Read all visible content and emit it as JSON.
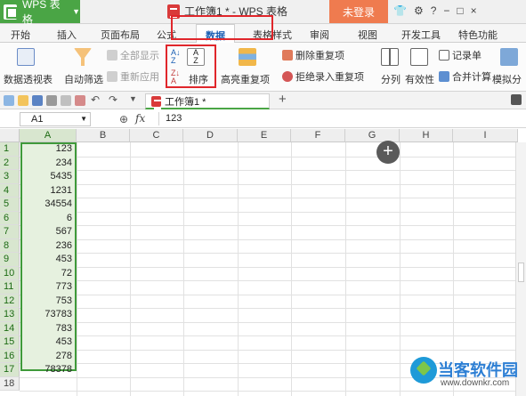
{
  "titlebar": {
    "app_name": "WPS 表格",
    "doc_title": "工作簿1 * - WPS 表格",
    "login": "未登录",
    "window_icons": [
      "T",
      "⊕",
      "?",
      "-",
      "□",
      "×"
    ]
  },
  "tabs": [
    "开始",
    "插入",
    "页面布局",
    "公式",
    "数据",
    "表格样式",
    "审阅",
    "视图",
    "开发工具",
    "特色功能"
  ],
  "active_tab": "数据",
  "ribbon": {
    "pivot": "数据透视表",
    "autofilter": "自动筛选",
    "show_all": "全部显示",
    "reapply": "重新应用",
    "sort": "排序",
    "highlight_dup": "高亮重复项",
    "remove_dup": "删除重复项",
    "reject_dup": "拒绝录入重复项",
    "split": "分列",
    "validity": "有效性",
    "record": "记录单",
    "consolidate": "合并计算",
    "simulate": "模拟分"
  },
  "sheet_tab": "工作簿1 *",
  "formula_bar": {
    "namebox": "A1",
    "fx": "fx",
    "value": "123"
  },
  "columns": [
    "A",
    "B",
    "C",
    "D",
    "E",
    "F",
    "G",
    "H",
    "I"
  ],
  "rows": [
    "1",
    "2",
    "3",
    "4",
    "5",
    "6",
    "7",
    "8",
    "9",
    "10",
    "11",
    "12",
    "13",
    "14",
    "15",
    "16",
    "17",
    "18"
  ],
  "column_a_values": [
    "123",
    "234",
    "5435",
    "1231",
    "34554",
    "6",
    "567",
    "236",
    "453",
    "72",
    "773",
    "753",
    "73783",
    "783",
    "453",
    "278",
    "78378"
  ],
  "watermark": {
    "text": "当客软件园",
    "url": "www.downkr.com"
  }
}
